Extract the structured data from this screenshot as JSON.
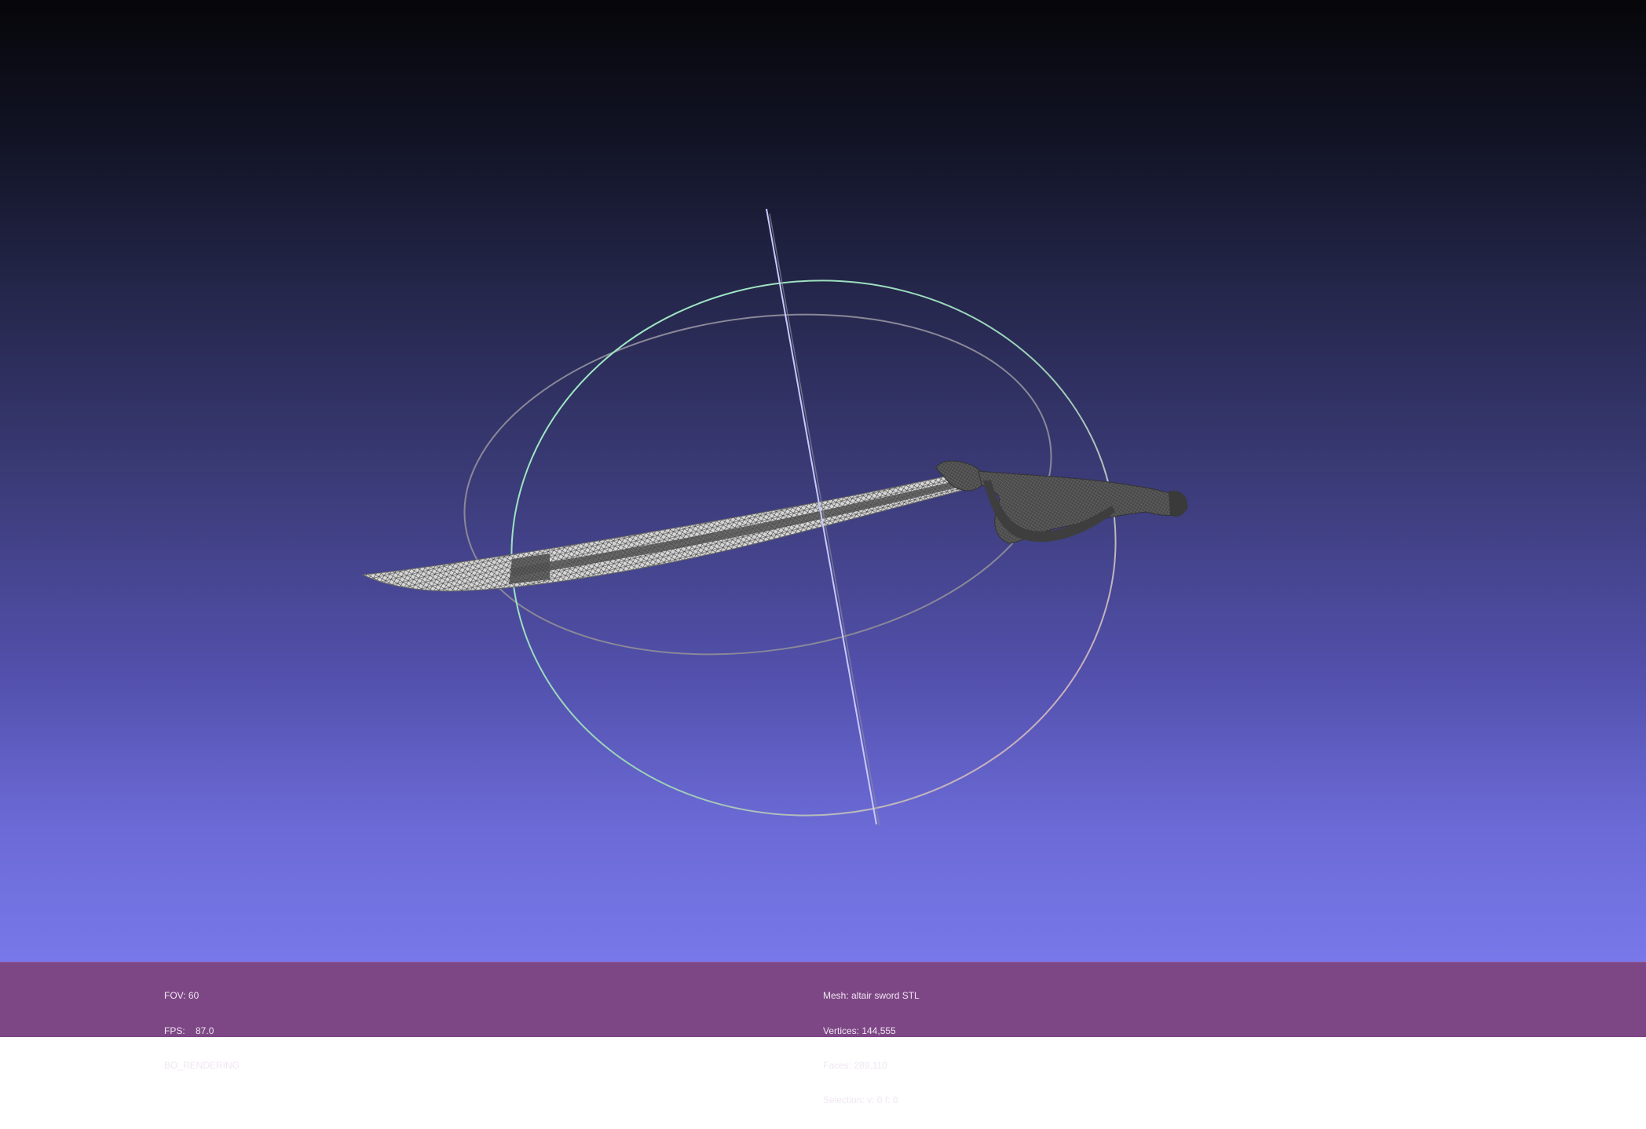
{
  "viewport": {
    "background_top": "#060609",
    "background_bottom": "#7878ea",
    "model": "sword-mesh",
    "trackball": {
      "ring_colors": [
        "#a0e0c8",
        "#e0a0c0",
        "#8a8898"
      ],
      "axis_color": "#c8c8ff"
    }
  },
  "status_bar": {
    "background": "#7d4785",
    "left": {
      "fov": "FOV: 60",
      "fps": "FPS:    87.0",
      "mode": "BO_RENDERING"
    },
    "right": {
      "mesh": "Mesh: altair sword STL",
      "vertices": "Vertices: 144,555",
      "faces": "Faces: 289,110",
      "selection": "Selection: v: 0 f: 0"
    }
  }
}
